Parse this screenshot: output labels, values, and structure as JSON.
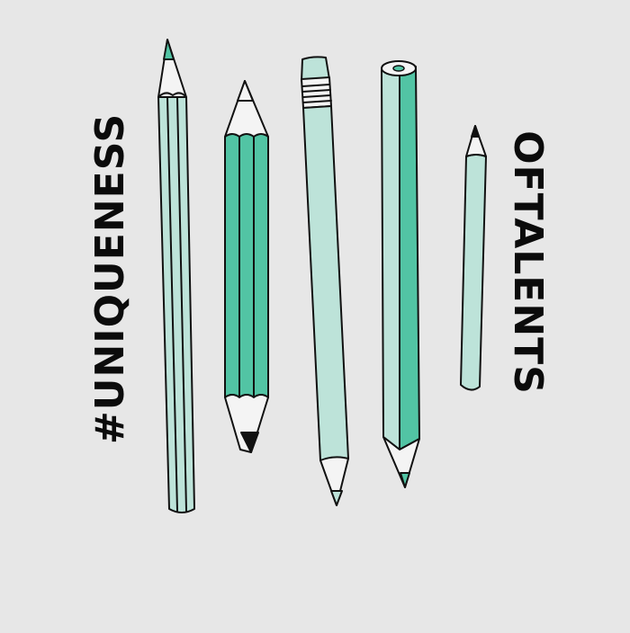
{
  "texts": {
    "left": "#UNIQUENESS",
    "right": "OFTALENTS"
  },
  "colors": {
    "background": "#e7e7e7",
    "light_mint": "#bde3d9",
    "green": "#52c4a4",
    "outline": "#111111"
  },
  "pencils": [
    {
      "name": "tall-striped-pencil-icon"
    },
    {
      "name": "striped-green-pencil-icon"
    },
    {
      "name": "eraser-pencil-icon"
    },
    {
      "name": "triangular-pencil-icon"
    },
    {
      "name": "short-pencil-icon"
    }
  ]
}
